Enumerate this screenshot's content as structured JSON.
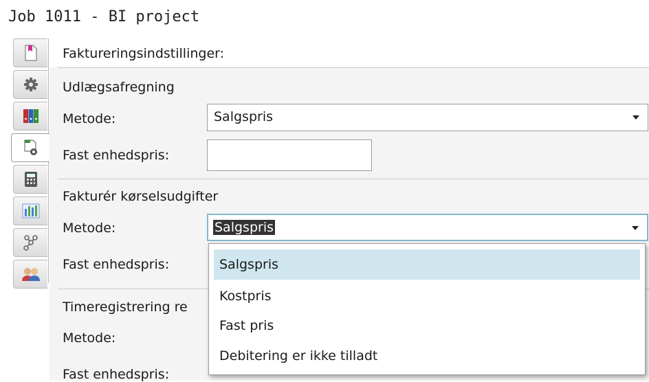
{
  "window": {
    "title": "Job 1011 - BI project"
  },
  "tabs": [
    {
      "icon": "bookmark-icon"
    },
    {
      "icon": "gear-icon"
    },
    {
      "icon": "binders-icon"
    },
    {
      "icon": "document-settings-icon",
      "active": true
    },
    {
      "icon": "calculator-icon"
    },
    {
      "icon": "bar-chart-icon"
    },
    {
      "icon": "network-icon"
    },
    {
      "icon": "users-icon"
    }
  ],
  "form": {
    "heading": "Faktureringsindstillinger:",
    "expenses": {
      "title": "Udlægsafregning",
      "method_label": "Metode:",
      "method_value": "Salgspris",
      "unit_price_label": "Fast enhedspris:",
      "unit_price_value": ""
    },
    "mileage": {
      "title": "Fakturér kørselsudgifter",
      "method_label": "Metode:",
      "method_value": "Salgspris",
      "unit_price_label": "Fast enhedspris:"
    },
    "time": {
      "title": "Timeregistrering re",
      "method_label": "Metode:",
      "unit_price_label": "Fast enhedspris:"
    }
  },
  "dropdown": {
    "options": [
      "Salgspris",
      "Kostpris",
      "Fast pris",
      "Debitering er ikke tilladt"
    ],
    "selected_index": 0
  },
  "colors": {
    "selected_option_bg": "#cfe6ee",
    "focus_border": "#7fb9cf",
    "panel_bg": "#f4f4f4"
  }
}
